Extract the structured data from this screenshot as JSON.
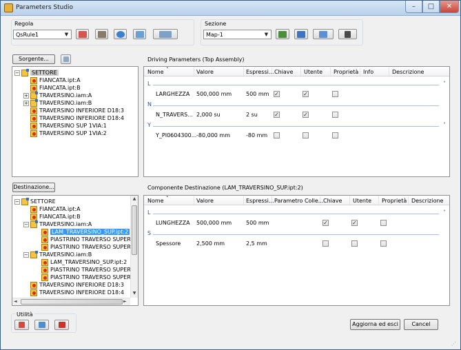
{
  "window": {
    "title": "Parameters Studio",
    "min": "–",
    "max": "□",
    "close": "✕"
  },
  "regola": {
    "label": "Regola",
    "value": "QsRule1"
  },
  "sezione": {
    "label": "Sezione",
    "value": "Map-1"
  },
  "source": {
    "button": "Sorgente..."
  },
  "destination": {
    "button": "Destinazione..."
  },
  "driving": {
    "title": "Driving Parameters (Top Assembly)",
    "columns": [
      "Nome",
      "Valore",
      "Espressi...",
      "Chiave",
      "Utente",
      "Proprietà",
      "Info",
      "Descrizione"
    ],
    "groups": [
      {
        "key": "L",
        "rows": [
          {
            "name": "LARGHEZZA",
            "value": "500,000 mm",
            "expr": "500 mm",
            "chiave": true,
            "utente": true,
            "prop": false
          }
        ]
      },
      {
        "key": "N",
        "rows": [
          {
            "name": "N_TRAVERS...",
            "value": "2,000 su",
            "expr": "2 su",
            "chiave": true,
            "utente": true,
            "prop": false
          }
        ]
      },
      {
        "key": "Y",
        "rows": [
          {
            "name": "Y_PI0604300...",
            "value": "-80,000 mm",
            "expr": "-80 mm",
            "chiave": false,
            "utente": false,
            "prop": false
          }
        ]
      }
    ]
  },
  "dest_grid": {
    "title": "Componente Destinazione (LAM_TRAVERSINO_SUP.ipt:2)",
    "columns": [
      "Nome",
      "Valore",
      "Espressi...",
      "Parametro Colle...",
      "Chiave",
      "Utente",
      "Proprietà",
      "Descrizione"
    ],
    "groups": [
      {
        "key": "L",
        "rows": [
          {
            "name": "LUNGHEZZA",
            "value": "500,000 mm",
            "expr": "500 mm",
            "chiave": true,
            "utente": true,
            "prop": false
          }
        ]
      },
      {
        "key": "S",
        "rows": [
          {
            "name": "Spessore",
            "value": "2,500 mm",
            "expr": "2,5 mm",
            "chiave": false,
            "utente": false,
            "prop": false
          }
        ]
      }
    ]
  },
  "source_tree": [
    "SETTORE",
    "FIANCATA.ipt:A",
    "FIANCATA.ipt:B",
    "TRAVERSINO.iam:A",
    "TRAVERSINO.iam:B",
    "TRAVERSINO INFERIORE D18:3",
    "TRAVERSINO INFERIORE D18:4",
    "TRAVERSINO SUP 1VIA:1",
    "TRAVERSINO SUP 1VIA:2"
  ],
  "dest_tree": [
    "SETTORE",
    "FIANCATA.ipt:A",
    "FIANCATA.ipt:B",
    "TRAVERSINO.iam:A",
    "LAM_TRAVERSINO_SUP.ipt:2",
    "PIASTRINO TRAVERSO SUPER",
    "PIASTRINO TRAVERSO SUPER",
    "TRAVERSINO.iam:B",
    "LAM_TRAVERSINO_SUP.ipt:2",
    "PIASTRINO TRAVERSO SUPER",
    "PIASTRINO TRAVERSO SUPER",
    "TRAVERSINO INFERIORE D18:3",
    "TRAVERSINO INFERIORE D18:4"
  ],
  "utility": {
    "label": "Utilità"
  },
  "footer": {
    "apply": "Aggiorna ed esci",
    "cancel": "Cancel"
  },
  "colors": {
    "accent": "#3399ff",
    "header_blue": "#1e4f9c"
  }
}
